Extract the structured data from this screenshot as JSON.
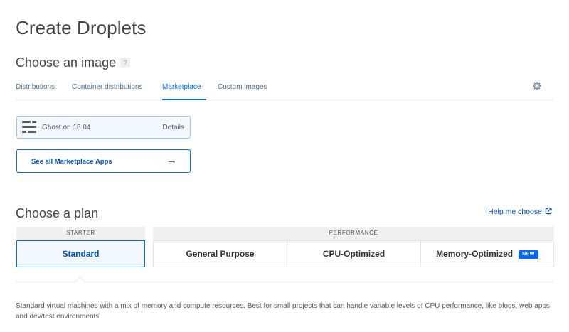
{
  "page_title": "Create Droplets",
  "image_section": {
    "title": "Choose an image",
    "help_badge": "?",
    "tabs": [
      {
        "label": "Distributions",
        "active": false
      },
      {
        "label": "Container distributions",
        "active": false
      },
      {
        "label": "Marketplace",
        "active": true
      },
      {
        "label": "Custom images",
        "active": false
      }
    ],
    "settings_icon": "gear-icon",
    "selected_image": {
      "name": "Ghost on 18.04",
      "details_label": "Details"
    },
    "see_all_label": "See all Marketplace Apps",
    "see_all_arrow": "→"
  },
  "plan_section": {
    "title": "Choose a plan",
    "help_link": "Help me choose",
    "groups": {
      "starter": "STARTER",
      "performance": "PERFORMANCE"
    },
    "plans": [
      {
        "label": "Standard",
        "selected": true
      },
      {
        "label": "General Purpose",
        "selected": false
      },
      {
        "label": "CPU-Optimized",
        "selected": false
      },
      {
        "label": "Memory-Optimized",
        "selected": false,
        "badge": "NEW"
      }
    ],
    "description": "Standard virtual machines with a mix of memory and compute resources. Best for small projects that can handle variable levels of CPU performance, like blogs, web apps and dev/test environments."
  },
  "colors": {
    "accent": "#0069ff",
    "link": "#0050c8",
    "selected_bg": "#f2f8ff"
  }
}
